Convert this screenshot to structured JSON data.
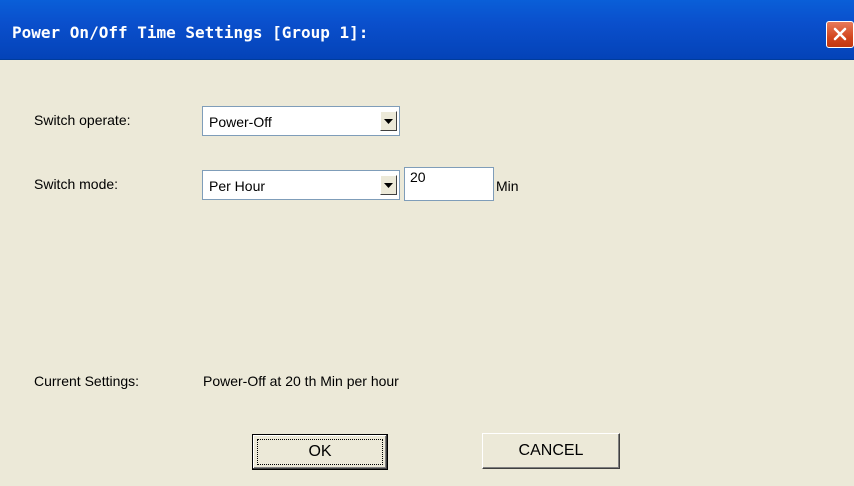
{
  "window": {
    "title": "Power On/Off Time Settings [Group 1]:"
  },
  "form": {
    "switch_operate_label": "Switch operate:",
    "switch_operate_value": "Power-Off",
    "switch_mode_label": "Switch  mode:",
    "switch_mode_value": "Per Hour",
    "minute_value": "20",
    "minute_unit": "Min",
    "current_settings_label": "Current Settings:",
    "current_settings_value": "Power-Off at 20 th Min per hour"
  },
  "buttons": {
    "ok_label": "OK",
    "cancel_label": "CANCEL"
  },
  "icons": {
    "close": "close-icon",
    "dropdown": "chevron-down-icon"
  },
  "colors": {
    "titlebar": "#0a4fcc",
    "dialog_background": "#ece9d8",
    "close_button": "#d4471f"
  }
}
